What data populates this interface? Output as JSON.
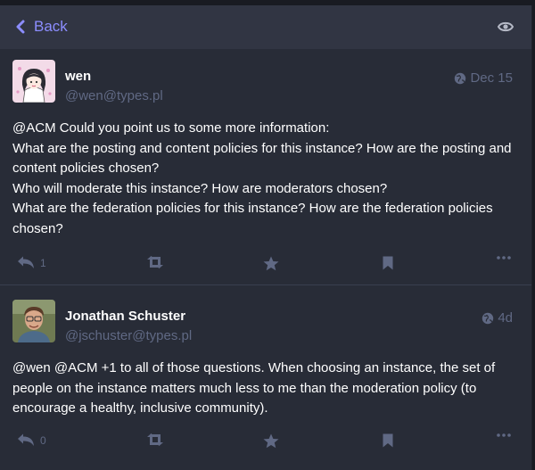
{
  "nav": {
    "back_label": "Back",
    "back_icon": "chevron-left-icon",
    "eye_icon": "eye-icon"
  },
  "colors": {
    "accent": "#8c8dff",
    "muted": "#606984",
    "panel": "#282c37",
    "header": "#313543",
    "background": "#191b22"
  },
  "statuses": [
    {
      "display_name": "wen",
      "handle": "@wen@types.pl",
      "time": "Dec 15",
      "visibility_icon": "globe-icon",
      "paragraphs": [
        "@ACM Could you point us to some more information:",
        "What are the posting and content policies for this instance? How are the posting and content policies chosen?",
        "Who will moderate this instance? How are moderators chosen?",
        "What are the federation policies for this instance? How are the federation policies chosen?"
      ],
      "reply_count": "1",
      "action_icons": [
        "reply-icon",
        "boost-icon",
        "star-icon",
        "bookmark-icon",
        "more-icon"
      ]
    },
    {
      "display_name": "Jonathan Schuster",
      "handle": "@jschuster@types.pl",
      "time": "4d",
      "visibility_icon": "globe-icon",
      "paragraphs": [
        "@wen @ACM +1 to all of those questions. When choosing an instance, the set of people on the instance matters much less to me than  the moderation policy (to encourage a healthy, inclusive community)."
      ],
      "reply_count": "0",
      "action_icons": [
        "reply-icon",
        "boost-icon",
        "star-icon",
        "bookmark-icon",
        "more-icon"
      ]
    }
  ]
}
